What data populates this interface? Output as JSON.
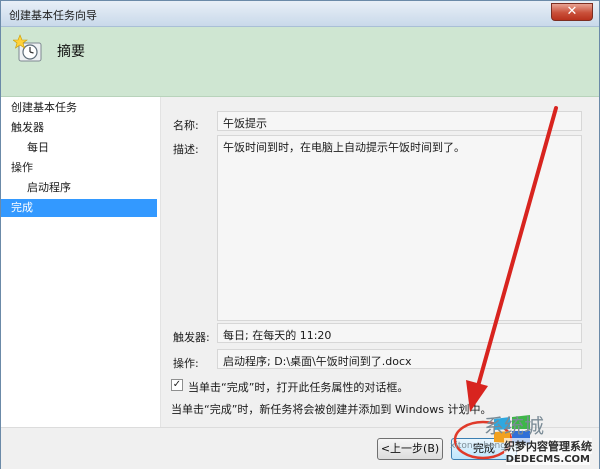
{
  "window": {
    "title": "创建基本任务向导",
    "close_label": "✕"
  },
  "header": {
    "heading": "摘要",
    "icon": "task-scheduler-icon"
  },
  "nav": {
    "items": [
      {
        "label": "创建基本任务",
        "level": "top",
        "active": false
      },
      {
        "label": "触发器",
        "level": "top",
        "active": false
      },
      {
        "label": "每日",
        "level": "sub",
        "active": false
      },
      {
        "label": "操作",
        "level": "top",
        "active": false
      },
      {
        "label": "启动程序",
        "level": "sub",
        "active": false
      },
      {
        "label": "完成",
        "level": "top",
        "active": true
      }
    ]
  },
  "summary": {
    "name_label": "名称:",
    "name_value": "午饭提示",
    "description_label": "描述:",
    "description_value": "午饭时间到时，在电脑上自动提示午饭时间到了。",
    "trigger_label": "触发器:",
    "trigger_value": "每日; 在每天的 11:20",
    "action_label": "操作:",
    "action_value": "启动程序; D:\\桌面\\午饭时间到了.docx"
  },
  "options": {
    "open_properties_checked": true,
    "open_properties_label": "当单击“完成”时，打开此任务属性的对话框。",
    "note": "当单击“完成”时，新任务将会被创建并添加到 Windows 计划中。"
  },
  "footer": {
    "back_label": "<上一步(B)",
    "finish_label": "完成"
  },
  "watermark": {
    "main": "系统城",
    "sub": "xitongcheng.com",
    "brand": "织梦内容管理系统",
    "url": "DEDECMS.COM"
  },
  "colors": {
    "header_bg": "#cfe6d2",
    "nav_active": "#3399ff",
    "arrow": "#d8241f"
  }
}
